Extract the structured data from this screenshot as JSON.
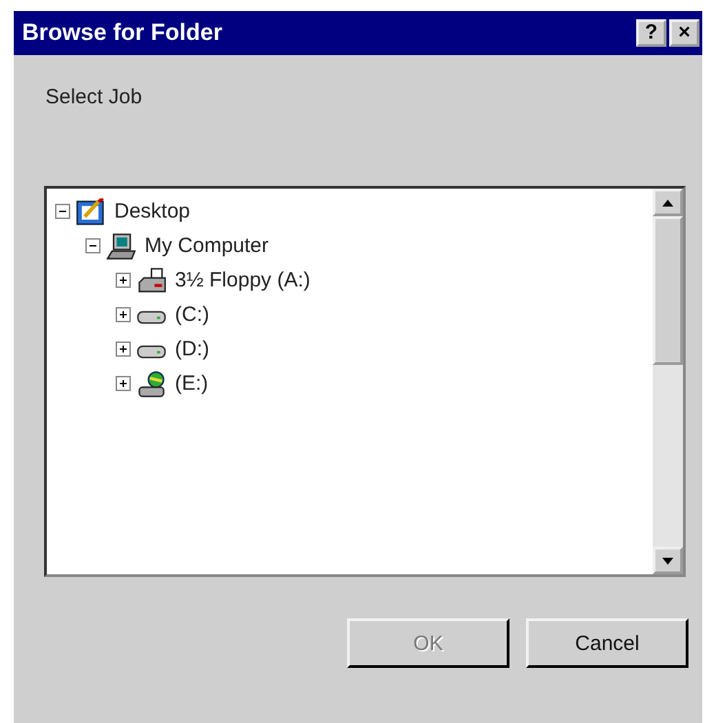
{
  "window": {
    "title": "Browse for Folder",
    "title_buttons": [
      "?",
      "×"
    ]
  },
  "prompt": "Select Job",
  "tree": [
    {
      "label": "Desktop",
      "kind": "desktop",
      "expanded": true,
      "children": [
        {
          "label": "My Computer",
          "kind": "computer",
          "expanded": true,
          "children": [
            {
              "label": "3½ Floppy (A:)",
              "kind": "floppy",
              "expanded": false
            },
            {
              "label": "(C:)",
              "kind": "drive",
              "expanded": false
            },
            {
              "label": "(D:)",
              "kind": "drive",
              "expanded": false
            },
            {
              "label": "(E:)",
              "kind": "netdrive",
              "expanded": false
            }
          ]
        }
      ]
    }
  ],
  "buttons": [
    {
      "label": "OK",
      "disabled": true
    },
    {
      "label": "Cancel",
      "disabled": false
    }
  ]
}
